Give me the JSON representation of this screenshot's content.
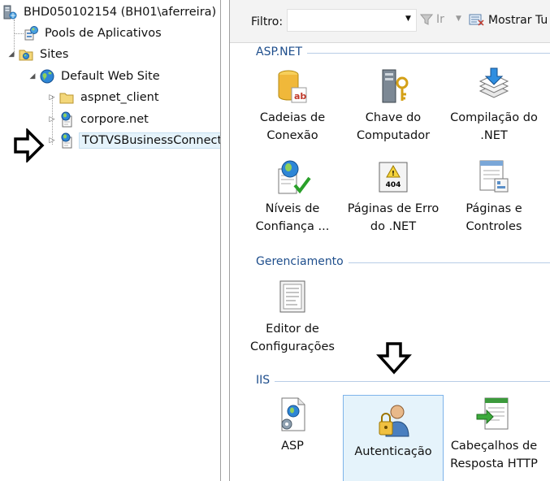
{
  "tree": {
    "server": "BHD050102154 (BH01\\aferreira)",
    "app_pools": "Pools de Aplicativos",
    "sites": "Sites",
    "default_site": "Default Web Site",
    "children": [
      "aspnet_client",
      "corpore.net",
      "TOTVSBusinessConnect"
    ]
  },
  "filter": {
    "label": "Filtro:",
    "value": "",
    "go_label": "Ir",
    "show_all_label": "Mostrar Tu"
  },
  "groups": [
    {
      "title": "ASP.NET",
      "features": [
        {
          "l1": "Cadeias de",
          "l2": "Conexão",
          "icon": "database-icon"
        },
        {
          "l1": "Chave do",
          "l2": "Computador",
          "icon": "machine-key-icon"
        },
        {
          "l1": "Compilação do",
          "l2": ".NET",
          "icon": "compilation-icon"
        },
        {
          "l1": "Níveis de",
          "l2": "Confiança ...",
          "icon": "trust-levels-icon"
        },
        {
          "l1": "Páginas de Erro",
          "l2": "do .NET",
          "icon": "error-404-icon"
        },
        {
          "l1": "Páginas e",
          "l2": "Controles",
          "icon": "pages-controls-icon"
        }
      ]
    },
    {
      "title": "Gerenciamento",
      "features": [
        {
          "l1": "Editor de",
          "l2": "Configurações",
          "icon": "config-editor-icon"
        }
      ]
    },
    {
      "title": "IIS",
      "features": [
        {
          "l1": "ASP",
          "l2": "",
          "icon": "asp-icon"
        },
        {
          "l1": "Autenticação",
          "l2": "",
          "icon": "authentication-icon"
        },
        {
          "l1": "Cabeçalhos de",
          "l2": "Resposta HTTP",
          "icon": "http-headers-icon"
        }
      ]
    }
  ],
  "colors": {
    "group_title": "#1e4e8c",
    "selection_bg": "#e5f3fb",
    "selection_border": "#7eb4ea"
  }
}
